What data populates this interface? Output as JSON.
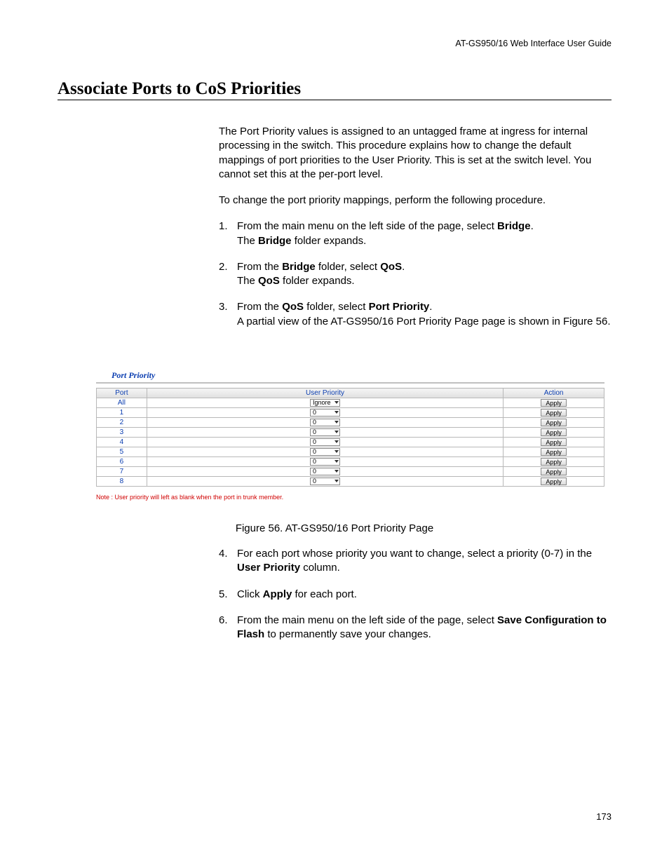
{
  "header": {
    "guide": "AT-GS950/16  Web Interface User Guide"
  },
  "title": "Associate Ports to CoS Priorities",
  "intro": {
    "p1": "The Port Priority values is assigned to an untagged frame at ingress for internal processing in the switch. This procedure explains how to change the default mappings of port priorities to the User Priority. This is set at the switch level. You cannot set this at the per-port level.",
    "p2": "To change the port priority mappings, perform the following procedure."
  },
  "steps1": [
    {
      "num": "1.",
      "pre": "From the main menu on the left side of the page, select ",
      "b1": "Bridge",
      "post": ".",
      "line2a": "The ",
      "b2": "Bridge",
      "line2b": " folder expands."
    },
    {
      "num": "2.",
      "pre": "From the ",
      "b1": "Bridge",
      "mid": " folder, select ",
      "b2": "QoS",
      "post": ".",
      "line2a": "The ",
      "b3": "QoS",
      "line2b": " folder expands."
    },
    {
      "num": "3.",
      "pre": "From the ",
      "b1": "QoS",
      "mid": " folder, select ",
      "b2": "Port Priority",
      "post": ".",
      "line2": "A partial view of the AT-GS950/16 Port Priority Page page is shown in Figure 56."
    }
  ],
  "figure": {
    "panelTitle": "Port Priority",
    "headers": {
      "port": "Port",
      "priority": "User Priority",
      "action": "Action"
    },
    "rows": [
      {
        "port": "All",
        "sel": "Ignore",
        "btn": "Apply"
      },
      {
        "port": "1",
        "sel": "0",
        "btn": "Apply"
      },
      {
        "port": "2",
        "sel": "0",
        "btn": "Apply"
      },
      {
        "port": "3",
        "sel": "0",
        "btn": "Apply"
      },
      {
        "port": "4",
        "sel": "0",
        "btn": "Apply"
      },
      {
        "port": "5",
        "sel": "0",
        "btn": "Apply"
      },
      {
        "port": "6",
        "sel": "0",
        "btn": "Apply"
      },
      {
        "port": "7",
        "sel": "0",
        "btn": "Apply"
      },
      {
        "port": "8",
        "sel": "0",
        "btn": "Apply"
      }
    ],
    "note": "Note : User priority will left as blank when the port in trunk member.",
    "caption": "Figure 56. AT-GS950/16 Port Priority Page"
  },
  "steps2": [
    {
      "num": "4.",
      "pre": "For each port whose priority you want to change, select a priority (0-7) in the ",
      "b1": "User Priority",
      "post": " column."
    },
    {
      "num": "5.",
      "pre": "Click ",
      "b1": "Apply",
      "post": " for each port."
    },
    {
      "num": "6.",
      "pre": "From the main menu on the left side of the page, select ",
      "b1": "Save Configuration to Flash",
      "post": " to permanently save your changes."
    }
  ],
  "pageNumber": "173"
}
